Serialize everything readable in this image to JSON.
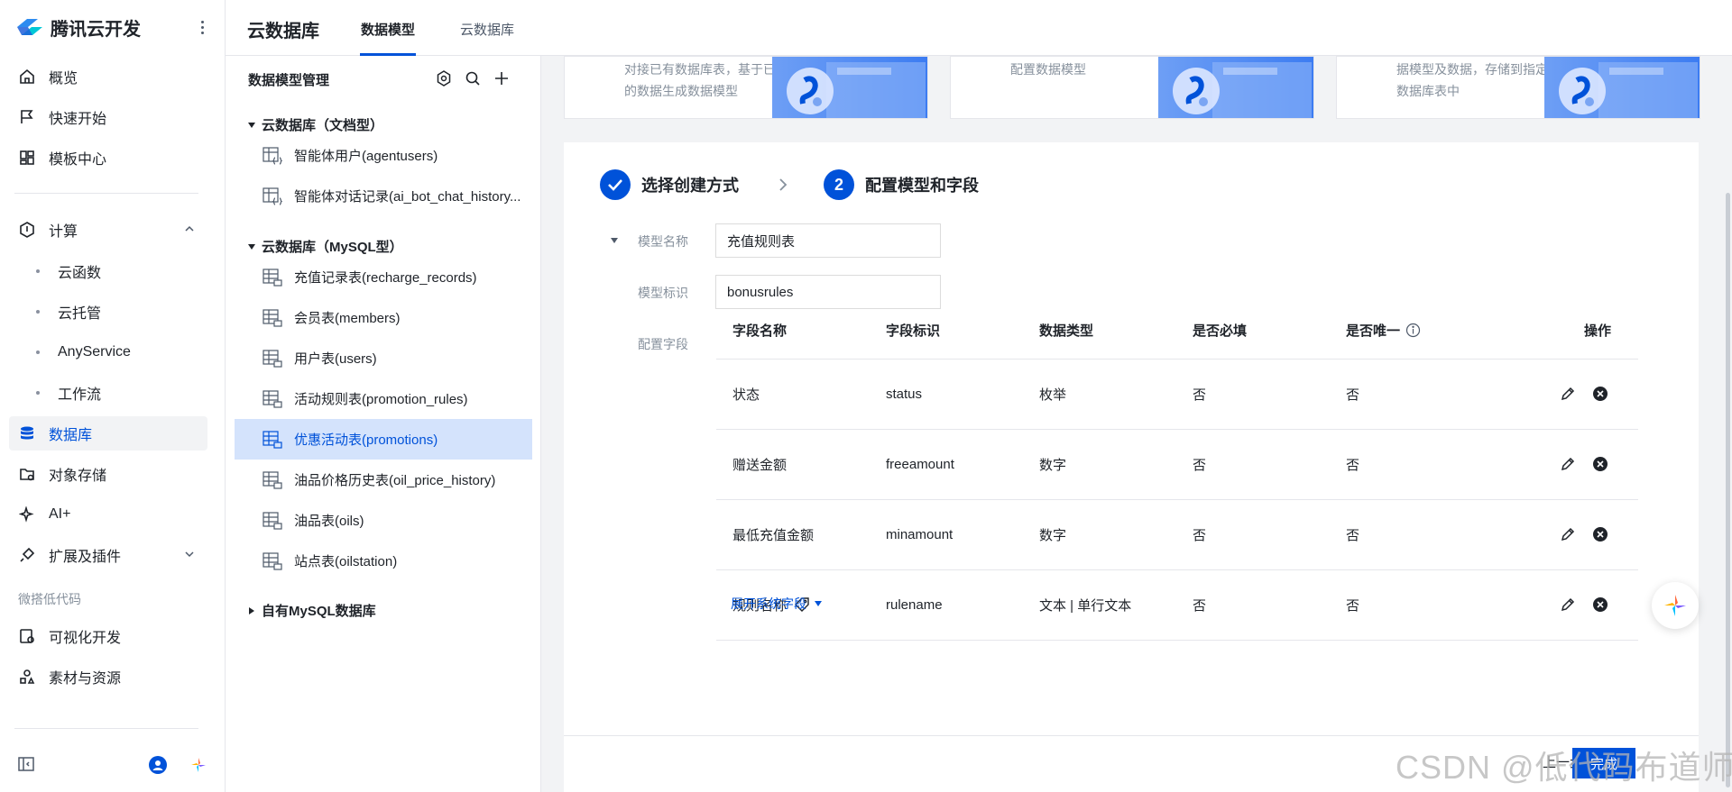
{
  "brand": {
    "name": "腾讯云开发"
  },
  "sidebar": {
    "items": [
      {
        "label": "概览"
      },
      {
        "label": "快速开始"
      },
      {
        "label": "模板中心"
      },
      {
        "label": "计算"
      },
      {
        "label": "云函数"
      },
      {
        "label": "云托管"
      },
      {
        "label": "AnyService"
      },
      {
        "label": "工作流"
      },
      {
        "label": "数据库"
      },
      {
        "label": "对象存储"
      },
      {
        "label": "AI+"
      },
      {
        "label": "扩展及插件"
      },
      {
        "label": "可视化开发"
      },
      {
        "label": "素材与资源"
      }
    ],
    "section_label": "微搭低代码"
  },
  "header": {
    "title": "云数据库",
    "tabs": [
      {
        "label": "数据模型"
      },
      {
        "label": "云数据库"
      }
    ]
  },
  "panel": {
    "title": "数据模型管理",
    "groups": [
      {
        "label": "云数据库（文档型）",
        "items": [
          "智能体用户(agentusers)",
          "智能体对话记录(ai_bot_chat_history..."
        ]
      },
      {
        "label": "云数据库（MySQL型）",
        "items": [
          "充值记录表(recharge_records)",
          "会员表(members)",
          "用户表(users)",
          "活动规则表(promotion_rules)",
          "优惠活动表(promotions)",
          "油品价格历史表(oil_price_history)",
          "油品表(oils)",
          "站点表(oilstation)"
        ]
      },
      {
        "label": "自有MySQL数据库",
        "items": []
      }
    ],
    "selected": "优惠活动表(promotions)"
  },
  "cards": [
    {
      "text": "对接已有数据库表，基于已有的数据生成数据模型"
    },
    {
      "text": "配置数据模型"
    },
    {
      "text": "据模型及数据，存储到指定的数据库表中"
    }
  ],
  "steps": [
    {
      "label": "选择创建方式",
      "done": true
    },
    {
      "number": "2",
      "label": "配置模型和字段"
    }
  ],
  "form": {
    "model_name_label": "模型名称",
    "model_name_value": "充值规则表",
    "model_id_label": "模型标识",
    "model_id_value": "bonusrules",
    "fields_label": "配置字段"
  },
  "table": {
    "headers": [
      "字段名称",
      "字段标识",
      "数据类型",
      "是否必填",
      "是否唯一",
      "操作"
    ],
    "rows": [
      {
        "name": "状态",
        "id": "status",
        "type": "枚举",
        "required": "否",
        "unique": "否"
      },
      {
        "name": "赠送金额",
        "id": "freeamount",
        "type": "数字",
        "required": "否",
        "unique": "否"
      },
      {
        "name": "最低充值金额",
        "id": "minamount",
        "type": "数字",
        "required": "否",
        "unique": "否"
      },
      {
        "name": "规则名称",
        "id": "rulename",
        "type": "文本 | 单行文本",
        "required": "否",
        "unique": "否"
      }
    ],
    "expand_label": "展开系统字段"
  },
  "footer": {
    "prev_label": "上一步",
    "done_label": "完成"
  },
  "watermark": "CSDN @低代码布道师",
  "colors": {
    "accent": "#0052d9",
    "selected_bg": "#d4e3fc"
  }
}
